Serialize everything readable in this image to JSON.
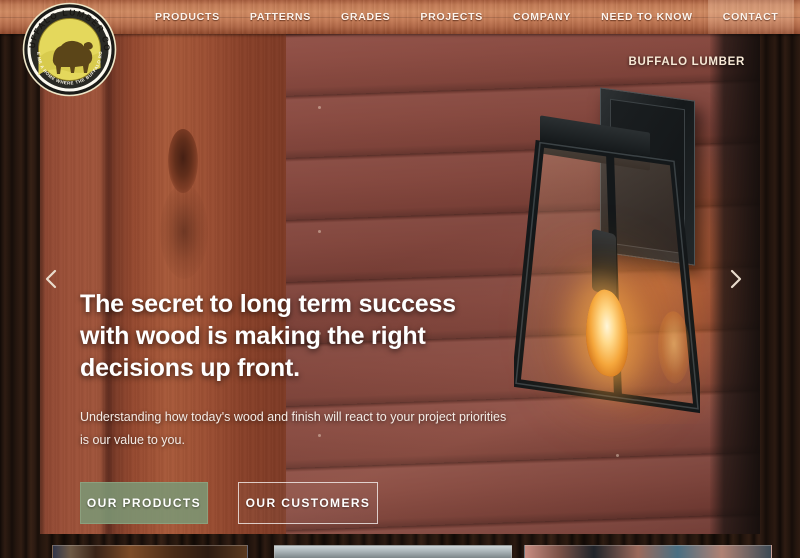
{
  "site": {
    "brand": "BUFFALO LUMBER CO.",
    "logo_tagline": "GIVE ME A HOME WHERE THE BUFFALO ROAM",
    "watermark": "BUFFALO LUMBER"
  },
  "nav": {
    "items": [
      {
        "label": "PRODUCTS",
        "active": false
      },
      {
        "label": "PATTERNS",
        "active": false
      },
      {
        "label": "GRADES",
        "active": false
      },
      {
        "label": "PROJECTS",
        "active": false
      },
      {
        "label": "COMPANY",
        "active": false
      },
      {
        "label": "NEED TO KNOW",
        "active": false
      },
      {
        "label": "CONTACT",
        "active": true
      }
    ]
  },
  "hero": {
    "title": "The secret to long term success with wood is making the right decisions up front.",
    "subtitle": "Understanding how today's wood and finish will react to your project priorities is our value to you.",
    "primary_button": "OUR PRODUCTS",
    "secondary_button": "OUR CUSTOMERS",
    "prev_arrow_icon": "chevron-left-icon",
    "next_arrow_icon": "chevron-right-icon"
  },
  "thumbnails": [
    {
      "name": "thumbnail-1"
    },
    {
      "name": "thumbnail-2"
    },
    {
      "name": "thumbnail-3"
    }
  ],
  "colors": {
    "nav_wood": "#c1714b",
    "page_wood_dark": "#2a1a12",
    "primary_button_bg": "#7c9674",
    "text_light": "#ffffff",
    "logo_gold": "#e6d24a"
  }
}
